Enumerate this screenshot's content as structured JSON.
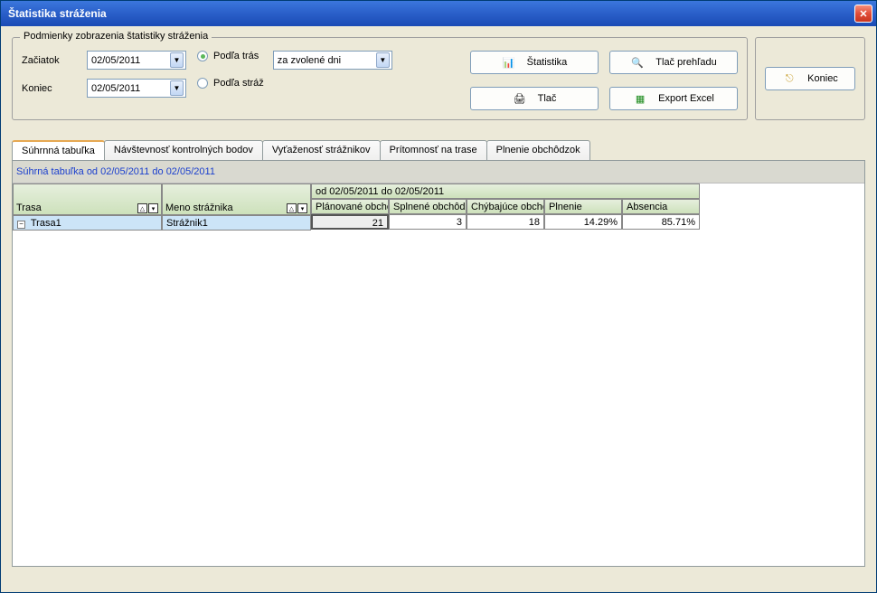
{
  "window": {
    "title": "Štatistika stráženia"
  },
  "filters": {
    "legend": "Podmienky zobrazenia štatistiky stráženia",
    "start_label": "Začiatok",
    "end_label": "Koniec",
    "start_value": "02/05/2011",
    "end_value": "02/05/2011",
    "radio_by_routes": "Podľa trás",
    "radio_by_guards": "Podľa stráž",
    "range_select_value": "za zvolené dni"
  },
  "buttons": {
    "stats": "Štatistika",
    "print_overview": "Tlač prehľadu",
    "print": "Tlač",
    "export_excel": "Export Excel",
    "exit": "Koniec"
  },
  "tabs": {
    "t0": "Súhrnná tabuľka",
    "t1": "Návštevnosť kontrolných bodov",
    "t2": "Vyťaženosť strážnikov",
    "t3": "Prítomnosť na trase",
    "t4": "Plnenie obchôdzok"
  },
  "summary_caption": "Súhrná tabuľka   od 02/05/2011 do 02/05/2011",
  "grid": {
    "period_header": "od 02/05/2011 do 02/05/2011",
    "col_route": "Trasa",
    "col_guard": "Meno strážnika",
    "col_planned": "Plánované obchô",
    "col_done": "Splnené obchôdz",
    "col_missing": "Chýbajúce obchô",
    "col_fulfilment": "Plnenie",
    "col_absence": "Absencia",
    "row": {
      "route": "Trasa1",
      "guard": "Strážnik1",
      "planned": "21",
      "done": "3",
      "missing": "18",
      "fulfilment": "14.29%",
      "absence": "85.71%"
    }
  }
}
